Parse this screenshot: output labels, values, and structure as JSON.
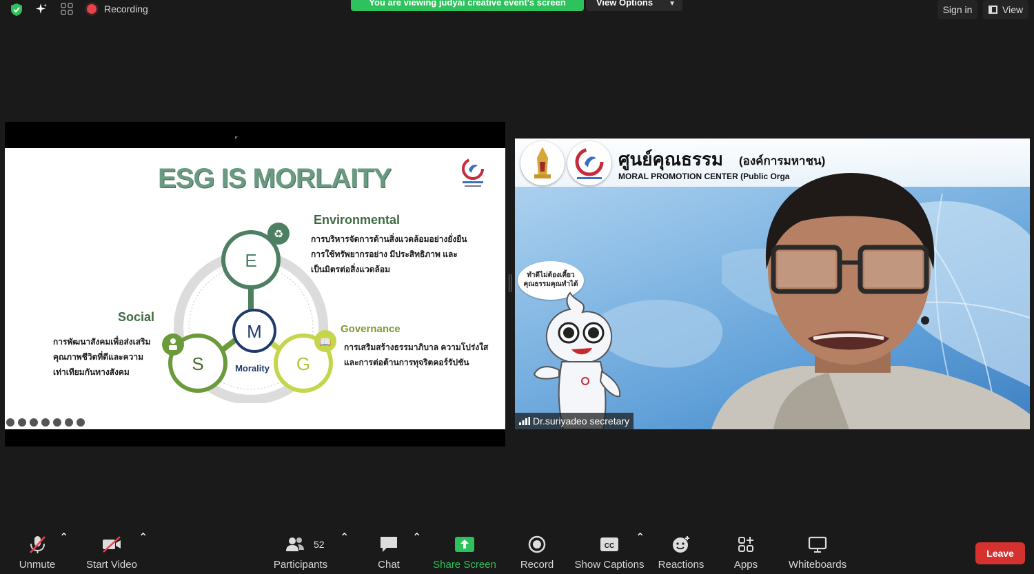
{
  "topbar": {
    "recording_label": "Recording",
    "banner_text": "You are viewing judyai creative event's screen",
    "view_options_label": "View Options",
    "sign_in_label": "Sign in",
    "view_label": "View"
  },
  "slide": {
    "title": "ESG IS MORLAITY",
    "environmental": {
      "title": "Environmental",
      "lines": [
        "การบริหารจัดการด้านสิ่งแวดล้อมอย่างยั่งยืน",
        "การใช้ทรัพยากรอย่าง มีประสิทธิภาพ และ",
        "เป็นมิตรต่อสิ่งแวดล้อม"
      ]
    },
    "social": {
      "title": "Social",
      "lines": [
        "การพัฒนาสังคมเพื่อส่งเสริม",
        "คุณภาพชีวิตที่ดีและความ",
        "เท่าเทียมกันทางสังคม"
      ]
    },
    "governance": {
      "title": "Governance",
      "lines": [
        "การเสริมสร้างธรรมาภิบาล ความโปร่งใส",
        "และการต่อต้านการทุจริตคอร์รัปชัน"
      ]
    },
    "circles": {
      "e": "E",
      "s": "S",
      "g": "G",
      "m": "M",
      "morality": "Morality"
    },
    "colors": {
      "title": "#6a9a82",
      "e": "#4e7f62",
      "s": "#6b9a3a",
      "g": "#c6d64a",
      "m": "#1f3a6b"
    }
  },
  "video": {
    "org_thai": "ศูนย์คุณธรรม",
    "org_thai_sub": "(องค์การมหาชน)",
    "org_en": "MORAL PROMOTION CENTER  (Public Orga",
    "bubble_lines": [
      "ทำดีไม่ต้องเคี้ยว",
      "คุณธรรมคุณทำได้"
    ],
    "participant_name": "Dr.suriyadeo secretary"
  },
  "toolbar": {
    "unmute": "Unmute",
    "start_video": "Start Video",
    "participants": "Participants",
    "participant_count": "52",
    "chat": "Chat",
    "share_screen": "Share Screen",
    "record": "Record",
    "show_captions": "Show Captions",
    "reactions": "Reactions",
    "apps": "Apps",
    "whiteboards": "Whiteboards",
    "leave": "Leave",
    "cc_label": "CC"
  },
  "colors": {
    "accent_green": "#2ec25c",
    "leave_red": "#d5312e",
    "bg": "#1a1a1a"
  }
}
